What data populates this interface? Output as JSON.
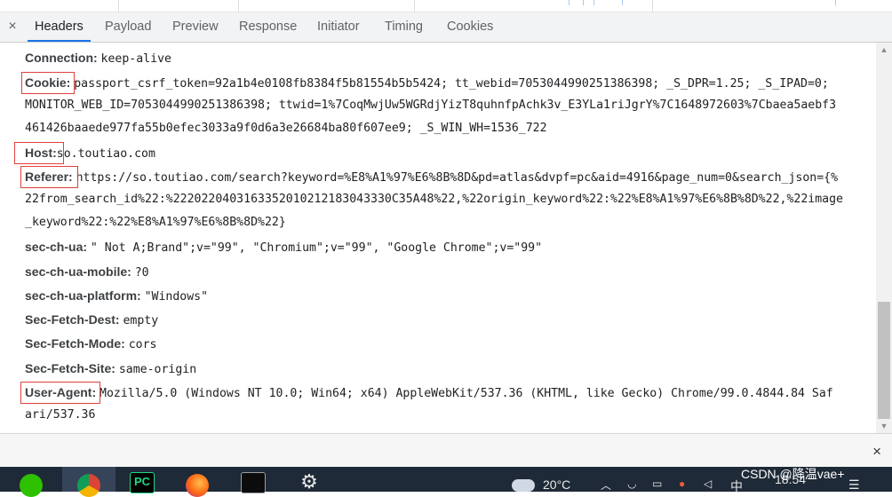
{
  "tabs": {
    "close": "×",
    "items": [
      "Headers",
      "Payload",
      "Preview",
      "Response",
      "Initiator",
      "Timing",
      "Cookies"
    ]
  },
  "headers": {
    "connection": {
      "name": "Connection:",
      "value": "keep-alive"
    },
    "cookie": {
      "name": "Cookie:",
      "value": "passport_csrf_token=92a1b4e0108fb8384f5b81554b5b5424; tt_webid=7053044990251386398; _S_DPR=1.25; _S_IPAD=0;",
      "cont": [
        "MONITOR_WEB_ID=7053044990251386398; ttwid=1%7CoqMwjUw5WGRdjYizT8quhnfpAchk3v_E3YLa1riJgrY%7C1648972603%7Cbaea5aebf3",
        "461426baaede977fa55b0efec3033a9f0d6a3e26684ba80f607ee9; _S_WIN_WH=1536_722"
      ]
    },
    "host": {
      "name": "Host:",
      "value": "so.toutiao.com"
    },
    "referer": {
      "name": "Referer:",
      "value": "https://so.toutiao.com/search?keyword=%E8%A1%97%E6%8B%8D&pd=atlas&dvpf=pc&aid=4916&page_num=0&search_json={%",
      "cont": [
        "22from_search_id%22:%2220220403163352010212183043330C35A48%22,%22origin_keyword%22:%22%E8%A1%97%E6%8B%8D%22,%22image",
        "_keyword%22:%22%E8%A1%97%E6%8B%8D%22}"
      ]
    },
    "sec_ch_ua": {
      "name": "sec-ch-ua:",
      "value": "\" Not A;Brand\";v=\"99\", \"Chromium\";v=\"99\", \"Google Chrome\";v=\"99\""
    },
    "sec_ch_ua_mobile": {
      "name": "sec-ch-ua-mobile:",
      "value": "?0"
    },
    "sec_ch_ua_platform": {
      "name": "sec-ch-ua-platform:",
      "value": "\"Windows\""
    },
    "sec_fetch_dest": {
      "name": "Sec-Fetch-Dest:",
      "value": "empty"
    },
    "sec_fetch_mode": {
      "name": "Sec-Fetch-Mode:",
      "value": "cors"
    },
    "sec_fetch_site": {
      "name": "Sec-Fetch-Site:",
      "value": "same-origin"
    },
    "user_agent": {
      "name": "User-Agent:",
      "value": "Mozilla/5.0 (Windows NT 10.0; Win64; x64) AppleWebKit/537.36 (KHTML, like Gecko) Chrome/99.0.4844.84 Saf",
      "cont": [
        "ari/537.36"
      ]
    }
  },
  "taskbar": {
    "apps": [
      "wechat-icon",
      "chrome-icon",
      "pycharm-icon",
      "firefox-icon",
      "terminal-icon",
      "settings-icon"
    ],
    "pycharm_label": "PC",
    "weather": "20°C",
    "lang": "中",
    "time": "18:54",
    "watermark": "CSDN @降温vae+"
  },
  "colors": {
    "highlight": "#e0403c",
    "accent": "#1a73e8",
    "taskbar": "#1f2a38"
  }
}
